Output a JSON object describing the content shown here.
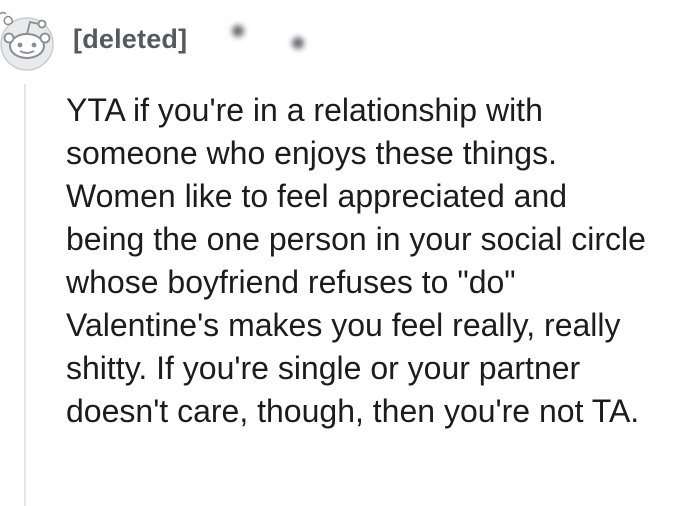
{
  "comment": {
    "author": "[deleted]",
    "avatar_icon": "snoo-avatar-icon",
    "body_lines": [
      "YTA if you're in a relationship with",
      "someone who enjoys these things.",
      "Women like to feel appreciated and",
      "being the one person in your social circle",
      "whose boyfriend refuses to \"do\"",
      "Valentine's makes you feel really, really",
      "shitty. If you're single or your partner",
      "doesn't care, though, then you're not TA."
    ]
  },
  "colors": {
    "author": "#555a60",
    "text": "#1c1c1c",
    "thread_line": "#e2e4e6"
  }
}
